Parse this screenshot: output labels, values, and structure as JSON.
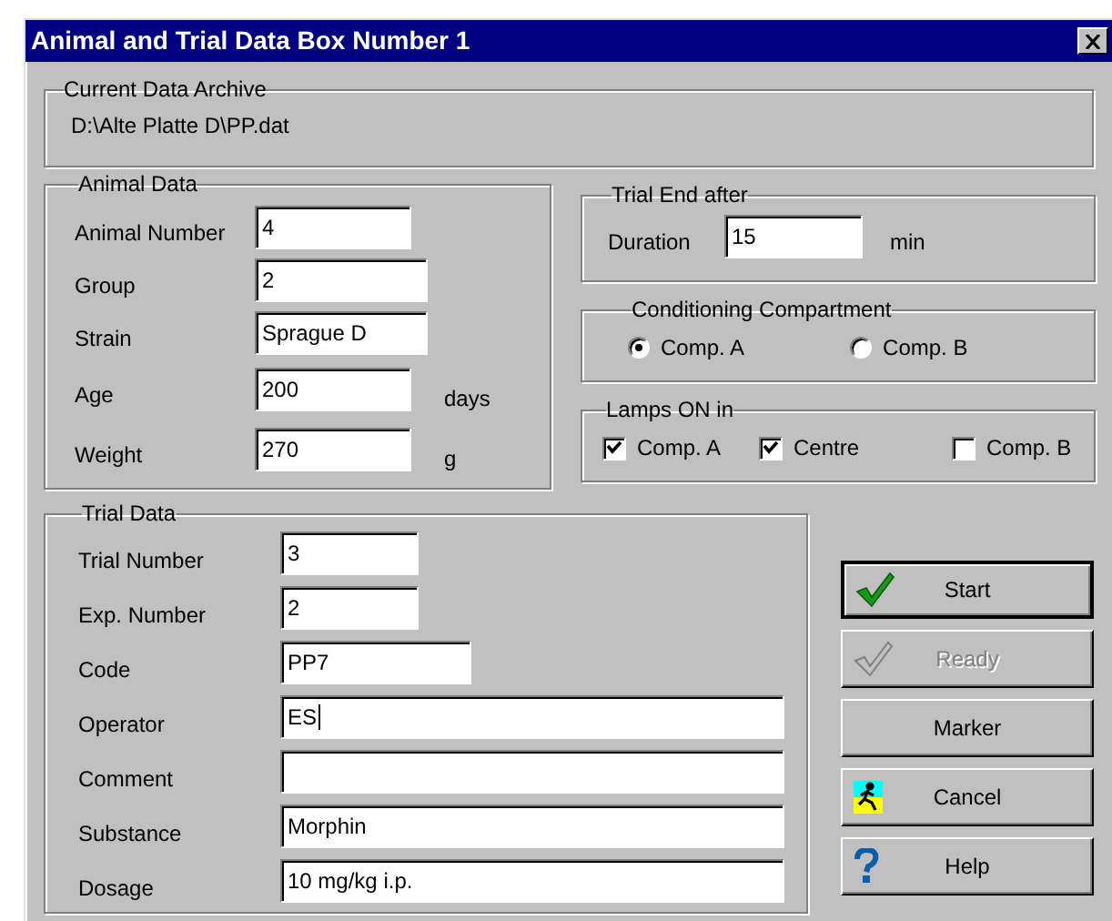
{
  "window": {
    "title": "Animal and Trial Data Box Number 1"
  },
  "archive": {
    "label": "Current Data Archive",
    "path": "D:\\Alte Platte D\\PP.dat"
  },
  "animal_data": {
    "label": "Animal Data",
    "fields": [
      {
        "label": "Animal Number",
        "value": "4"
      },
      {
        "label": "Group",
        "value": "2"
      },
      {
        "label": "Strain",
        "value": "Sprague D"
      },
      {
        "label": "Age",
        "value": "200",
        "unit": "days"
      },
      {
        "label": "Weight",
        "value": "270",
        "unit": "g"
      }
    ]
  },
  "trial_end": {
    "label": "Trial End after",
    "field_label": "Duration",
    "value": "15",
    "unit": "min"
  },
  "conditioning": {
    "label": "Conditioning Compartment",
    "options": [
      {
        "label": "Comp. A",
        "selected": true
      },
      {
        "label": "Comp. B",
        "selected": false
      }
    ]
  },
  "lamps": {
    "label": "Lamps ON in",
    "options": [
      {
        "label": "Comp. A",
        "checked": true
      },
      {
        "label": "Centre",
        "checked": true
      },
      {
        "label": "Comp. B",
        "checked": false
      }
    ]
  },
  "trial_data": {
    "label": "Trial Data",
    "fields": [
      {
        "label": "Trial Number",
        "value": "3",
        "focused": false
      },
      {
        "label": "Exp. Number",
        "value": "2",
        "focused": false
      },
      {
        "label": "Code",
        "value": "PP7",
        "focused": false
      },
      {
        "label": "Operator",
        "value": "ES",
        "focused": true
      },
      {
        "label": "Comment",
        "focused": false
      },
      {
        "label": "Substance",
        "value": "Morphin",
        "focused": false
      },
      {
        "label": "Dosage",
        "value": "10 mg/kg i.p.",
        "focused": false
      }
    ]
  },
  "buttons": [
    {
      "label": "Start",
      "kind": "start",
      "disabled": false,
      "default": true
    },
    {
      "label": "Ready",
      "kind": "ready",
      "disabled": true,
      "default": false
    },
    {
      "label": "Marker",
      "kind": "plain",
      "disabled": false,
      "default": false
    },
    {
      "label": "Cancel",
      "kind": "cancel",
      "disabled": false,
      "default": false
    },
    {
      "label": "Help",
      "kind": "help",
      "disabled": false,
      "default": false
    }
  ]
}
